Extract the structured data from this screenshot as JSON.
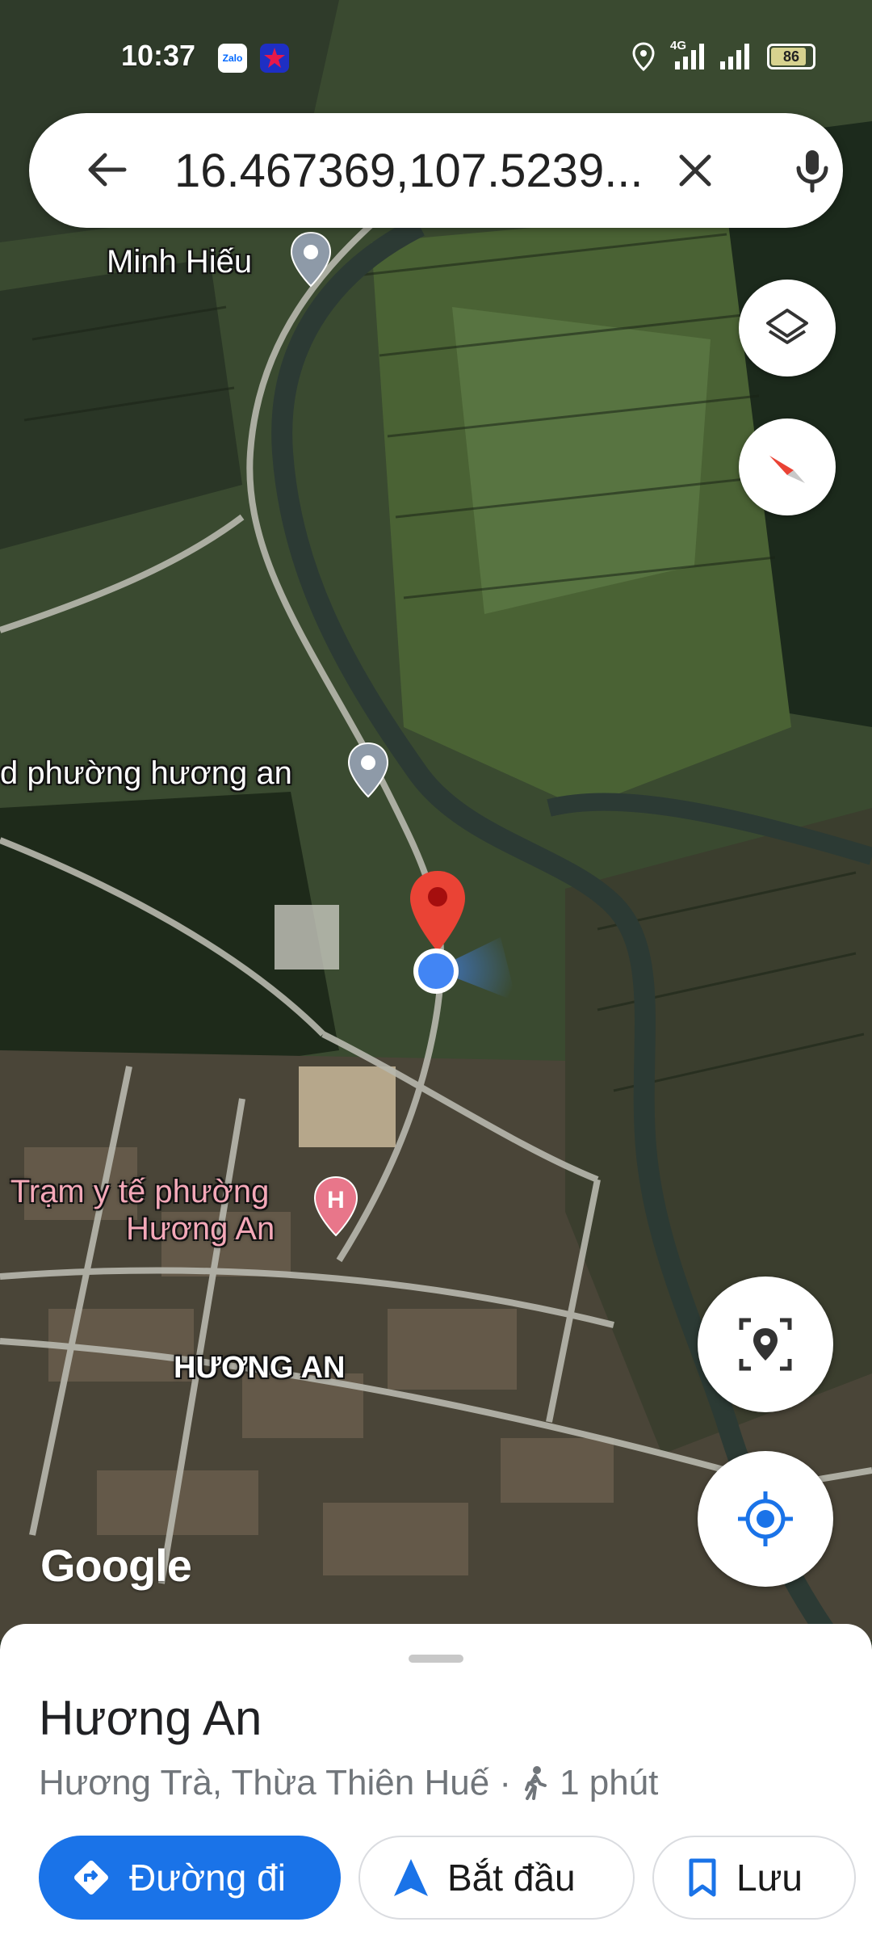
{
  "status_bar": {
    "time": "10:37",
    "battery": "86",
    "network": "4G",
    "icons": [
      "zalo-icon",
      "star-app-icon",
      "location-icon",
      "signal-icon",
      "battery-icon"
    ]
  },
  "search": {
    "query": "16.467369,107.5239...",
    "icons": [
      "back-arrow-icon",
      "close-icon",
      "microphone-icon"
    ]
  },
  "map": {
    "labels": {
      "minh_hieu": "Minh Hiếu",
      "ward_office": "d phường hương an",
      "clinic_line1": "Trạm y tế phường",
      "clinic_line2": "Hương An",
      "area": "HƯƠNG AN"
    },
    "watermark": "Google",
    "controls": [
      "layers-icon",
      "compass-icon",
      "place-search-icon",
      "my-location-icon"
    ]
  },
  "place_sheet": {
    "title": "Hương An",
    "subtitle": "Hương Trà, Thừa Thiên Huế ·",
    "walk_time": "1 phút",
    "buttons": {
      "directions": "Đường đi",
      "start": "Bắt đầu",
      "save": "Lưu"
    }
  },
  "colors": {
    "accent": "#1a73e8",
    "pin_red": "#ea4335",
    "location_blue": "#4285f4"
  }
}
